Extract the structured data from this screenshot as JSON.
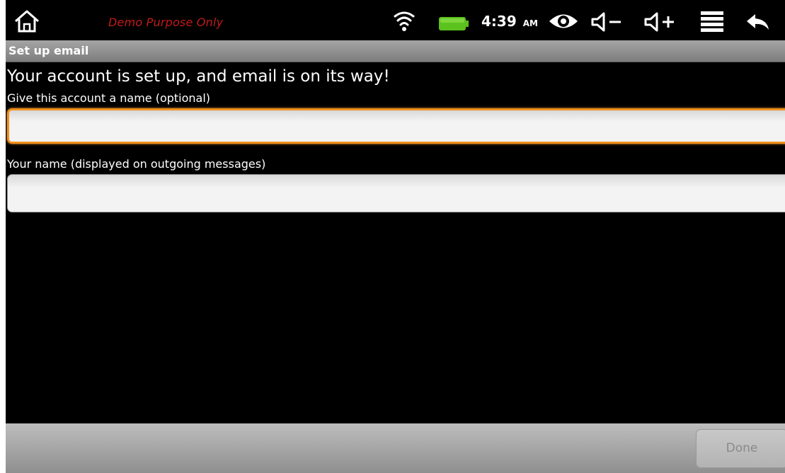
{
  "status_bar": {
    "watermark": "Demo Purpose Only",
    "time": "4:39",
    "ampm": "AM",
    "icons": [
      "home-icon",
      "wifi-icon",
      "battery-icon",
      "eye-icon",
      "volume-down-icon",
      "volume-up-icon",
      "menu-icon",
      "back-icon"
    ],
    "battery_color": "#5cc21e",
    "watermark_color": "#c41a1a"
  },
  "title_bar": {
    "title": "Set up email"
  },
  "main": {
    "headline": "Your account is set up, and email is on its way!",
    "account_name_label": "Give this account a name (optional)",
    "account_name_value": "",
    "your_name_label": "Your name (displayed on outgoing messages)",
    "your_name_value": "",
    "focus_color": "#f0901e"
  },
  "bottom_bar": {
    "done_label": "Done"
  }
}
